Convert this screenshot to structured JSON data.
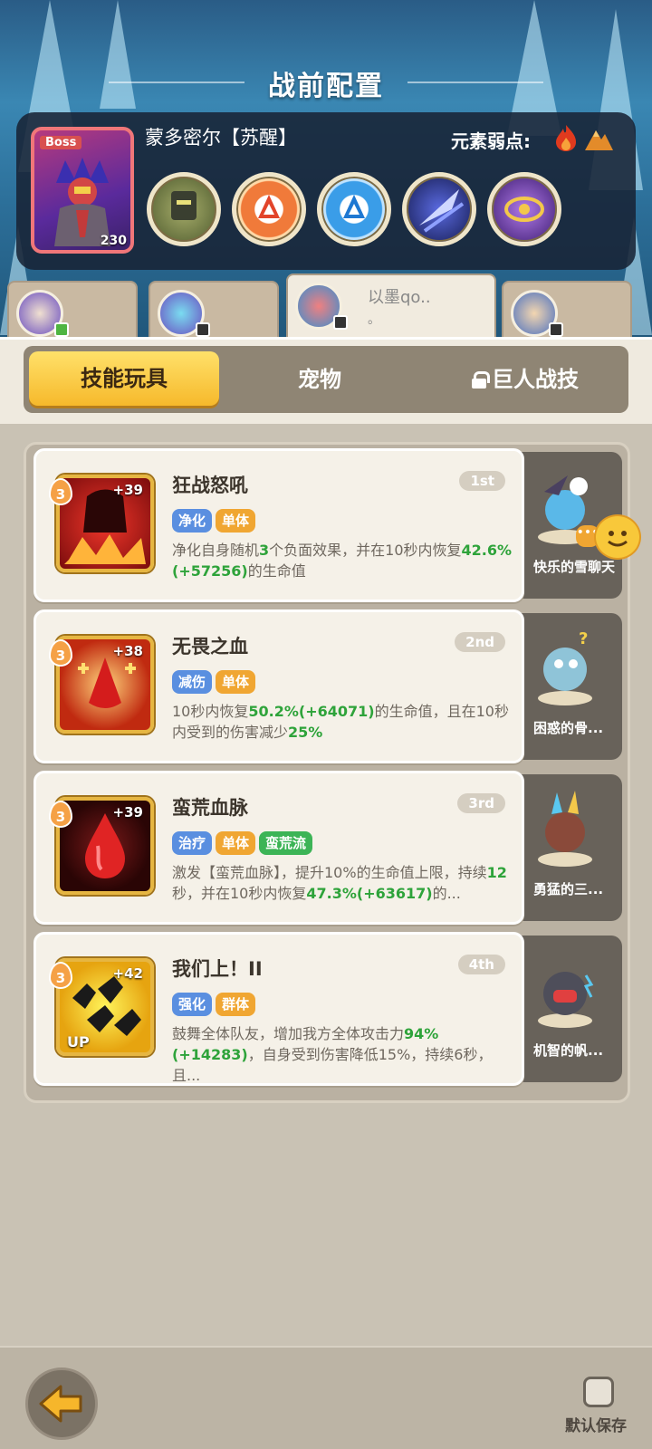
{
  "header": {
    "title": "战前配置",
    "boss_tag": "Boss",
    "boss_level": "230",
    "boss_name": "蒙多密尔【苏醒】",
    "weakness_label": "元素弱点:",
    "weakness_icons": [
      "fire-icon",
      "earth-icon"
    ],
    "boss_skill_icons": [
      "stone-golem-icon",
      "fire-element-icon",
      "water-element-icon",
      "dark-slash-icon",
      "arcane-eye-icon"
    ]
  },
  "hero_tabs": [
    {
      "name": "",
      "badge": "green"
    },
    {
      "name": "",
      "badge": "dark"
    },
    {
      "name": "以墨qo..",
      "sub": "。",
      "badge": "dark",
      "active": true
    },
    {
      "name": "",
      "badge": "dark"
    }
  ],
  "tabs": {
    "skill_toys": "技能玩具",
    "pets": "宠物",
    "giant_skills": "巨人战技"
  },
  "skills": [
    {
      "name": "狂战怒吼",
      "rank": "1st",
      "level": "3",
      "plus": "+39",
      "tags": [
        {
          "label": "净化",
          "color": "blue"
        },
        {
          "label": "单体",
          "color": "orange"
        }
      ],
      "desc_parts": [
        "净化自身随机",
        "3",
        "个负面效果，并在10秒内恢复",
        "42.6%(+57256)",
        "的生命值"
      ],
      "pet_name": "快乐的雪聊天"
    },
    {
      "name": "无畏之血",
      "rank": "2nd",
      "level": "3",
      "plus": "+38",
      "tags": [
        {
          "label": "减伤",
          "color": "blue"
        },
        {
          "label": "单体",
          "color": "orange"
        }
      ],
      "desc_parts": [
        "10秒内恢复",
        "50.2%(+64071)",
        "的生命值，且在10秒内受到的伤害减少",
        "25%",
        ""
      ],
      "pet_name": "困惑的骨..."
    },
    {
      "name": "蛮荒血脉",
      "rank": "3rd",
      "level": "3",
      "plus": "+39",
      "tags": [
        {
          "label": "治疗",
          "color": "blue"
        },
        {
          "label": "单体",
          "color": "orange"
        },
        {
          "label": "蛮荒流",
          "color": "green"
        }
      ],
      "desc_parts": [
        "激发【蛮荒血脉】，提升10%的生命值上限，持续",
        "12",
        "秒，并在10秒内恢复",
        "47.3%(+63617)",
        "的..."
      ],
      "pet_name": "勇猛的三..."
    },
    {
      "name": "我们上！II",
      "rank": "4th",
      "level": "3",
      "plus": "+42",
      "up": "UP",
      "tags": [
        {
          "label": "强化",
          "color": "blue"
        },
        {
          "label": "群体",
          "color": "orange"
        }
      ],
      "desc_parts": [
        "鼓舞全体队友，增加我方全体攻击力",
        "94%(+14283)",
        "，自身受到伤害降低15%，持续6秒，且...",
        "",
        ""
      ],
      "pet_name": "机智的帆..."
    }
  ],
  "bottom": {
    "save_label": "默认保存"
  }
}
